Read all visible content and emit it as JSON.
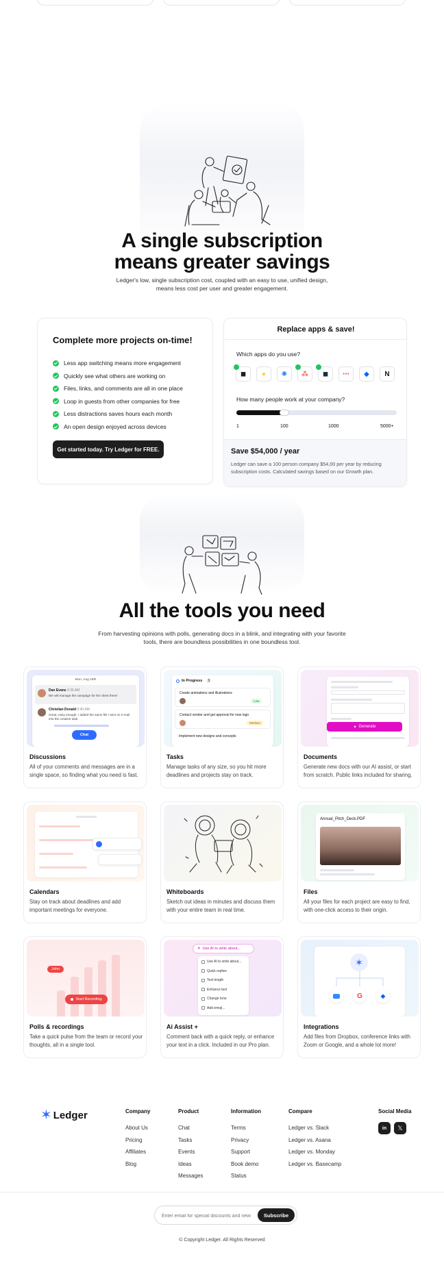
{
  "savings": {
    "title_line1": "A single subscription",
    "title_line2": "means greater savings",
    "subtitle_line1": "Ledger's low, single subscription cost, coupled with an easy to use, unified design,",
    "subtitle_line2": "means less cost per user and greater engagement.",
    "left_card": {
      "title": "Complete more projects on-time!",
      "items": [
        "Less app switching means more engagement",
        "Quickly see what others are working on",
        "Files, links, and comments are all in one place",
        "Loop in guests from other companies for free",
        "Less distractions saves hours each month",
        "An open design enjoyed across devices"
      ],
      "cta": "Get started today. Try Ledger for FREE."
    },
    "right_card": {
      "title": "Replace apps & save!",
      "apps_question": "Which apps do you use?",
      "apps": [
        {
          "name": "figma-icon",
          "selected": true
        },
        {
          "name": "miro-icon",
          "selected": false
        },
        {
          "name": "jira-icon",
          "selected": false
        },
        {
          "name": "asana-icon",
          "selected": true
        },
        {
          "name": "basecamp-icon",
          "selected": true
        },
        {
          "name": "monday-icon",
          "selected": false
        },
        {
          "name": "dropbox-icon",
          "selected": false
        },
        {
          "name": "notion-icon",
          "selected": false
        }
      ],
      "people_question": "How many people work at your company?",
      "slider_value_fraction": 0.3,
      "slider_ticks": [
        "1",
        "100",
        "1000",
        "5000+"
      ],
      "save_title": "Save $54,000 / year",
      "save_text_line1": "Ledger can save a 100 person company $54,00 per year by reducing",
      "save_text_line2": "subscription costs. Calculated savings based on our Growth plan."
    }
  },
  "tools": {
    "title": "All the tools you need",
    "subtitle_line1": "From harvesting opinions with polls, generating docs in a blink, and integrating with your favorite",
    "subtitle_line2": "tools, there are boundless possibilities in one boundless tool.",
    "tiles": [
      {
        "title": "Discussions",
        "desc": "All of your comments and messages are in a single space, so finding what you need is fast."
      },
      {
        "title": "Tasks",
        "desc": "Manage tasks of any size, so you hit more deadlines and projects stay on track."
      },
      {
        "title": "Documents",
        "desc": "Generate new docs with our AI assist, or start from scratch. Public links included for sharing."
      },
      {
        "title": "Calendars",
        "desc": "Stay on track about deadlines and add important meetings for everyone."
      },
      {
        "title": "Whiteboards",
        "desc": "Sketch out ideas in minutes and discuss them with your entire team in real time."
      },
      {
        "title": "Files",
        "desc": "All your files for each project are easy to find, with one-click access to their origin."
      },
      {
        "title": "Polls & recordings",
        "desc": "Take a quick pulse from the team or record your thoughts, all in a single tool."
      },
      {
        "title": "Ai Assist +",
        "desc": "Comment back with a quick reply, or enhance your text in a click. Included in our Pro plan."
      },
      {
        "title": "Integrations",
        "desc": "Add files from Dropbox, conference links with Zoom or Google, and a whole lot more!"
      }
    ],
    "discussion": {
      "date": "Mon, Aug 18th",
      "user1": "Dan Evans",
      "time1": "9:36 AM",
      "msg1": "We will manage the campaign for the client there!",
      "user2": "Christian Donald",
      "time2": "9:40 AM",
      "msg2": "Great, easy enough. I added the same file I sent on e-mail into the creative task.",
      "button": "Chat"
    },
    "tasks": {
      "status": "In Progress",
      "count": "3",
      "t1": "Create animations and illustrations",
      "t2": "Contact vendor and get approval for new logo",
      "t3": "Implement new designs and concepts",
      "badge1": "Low",
      "badge2": "Medium"
    },
    "documents": {
      "button": "Generate"
    },
    "files": {
      "filename": "Annual_Pitch_Deck.PDF"
    },
    "polls": {
      "user_tag": "John",
      "button": "Start Recording"
    },
    "ai": {
      "prompt": "Use AI to write about...",
      "options": [
        "Use AI to write about...",
        "Quick replies",
        "Text length",
        "Enhance text",
        "Change tone",
        "Add emoji..."
      ]
    }
  },
  "footer": {
    "brand": "Ledger",
    "columns": [
      {
        "title": "Company",
        "links": [
          "About Us",
          "Pricing",
          "Affiliates",
          "Blog"
        ]
      },
      {
        "title": "Product",
        "links": [
          "Chat",
          "Tasks",
          "Events",
          "Ideas",
          "Messages"
        ]
      },
      {
        "title": "Information",
        "links": [
          "Terms",
          "Privacy",
          "Support",
          "Book demo",
          "Status"
        ]
      },
      {
        "title": "Compare",
        "links": [
          "Ledger vs. Slack",
          "Ledger vs. Asana",
          "Ledger vs. Monday",
          "Ledger vs. Basecamp"
        ]
      }
    ],
    "social_title": "Social Media",
    "social": [
      "linkedin-icon",
      "x-icon"
    ],
    "email_placeholder": "Enter email for special discounts and news",
    "subscribe": "Subscribe",
    "copyright": "© Copyright Ledger. All Rights Reserved"
  }
}
